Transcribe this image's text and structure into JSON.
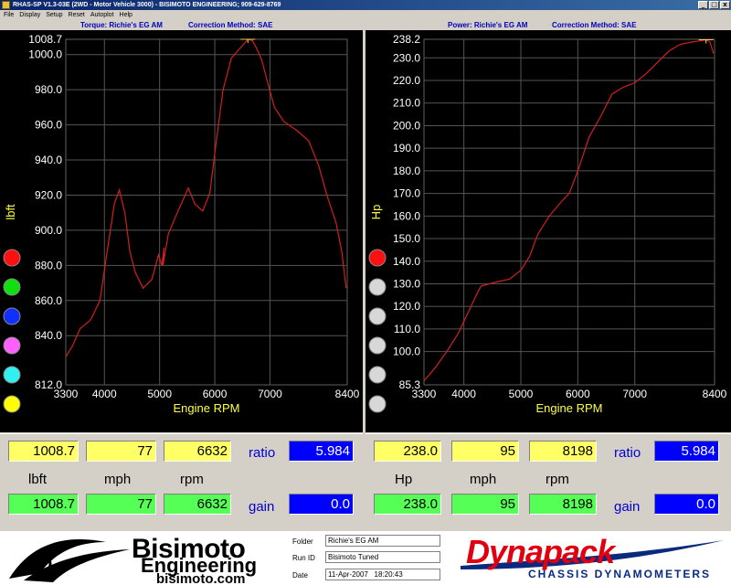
{
  "window": {
    "title": "RHAS-SP V1.3-03E  (2WD - Motor Vehicle 3000) - BISIMOTO ENGINEERING; 909-629-8769",
    "buttons": [
      "_",
      "□",
      "x"
    ]
  },
  "menu": [
    "File",
    "Display",
    "Setup",
    "Reset",
    "Autoplot",
    "Help"
  ],
  "torque": {
    "header_title": "Torque: Richie's EG AM",
    "header_method": "Correction Method: SAE",
    "ylabel": "lbft",
    "xlabel": "Engine RPM",
    "line_color": "#d02020",
    "run_buttons": [
      {
        "name": "red",
        "color": "#ff1010"
      },
      {
        "name": "green",
        "color": "#10e010"
      },
      {
        "name": "blue",
        "color": "#1030ff"
      },
      {
        "name": "magenta",
        "color": "#ff60ff"
      },
      {
        "name": "cyan",
        "color": "#30f0f0"
      },
      {
        "name": "yellow",
        "color": "#ffff00"
      }
    ],
    "readout": {
      "value1": "1008.7",
      "value2": "77",
      "value3": "6632",
      "ratio_label": "ratio",
      "ratio_value": "5.984",
      "unit1": "lbft",
      "unit2": "mph",
      "unit3": "rpm",
      "gvalue1": "1008.7",
      "gvalue2": "77",
      "gvalue3": "6632",
      "gain_label": "gain",
      "gain_value": "0.0"
    }
  },
  "power": {
    "header_title": "Power: Richie's EG AM",
    "header_method": "Correction Method: SAE",
    "ylabel": "Hp",
    "xlabel": "Engine RPM",
    "line_color": "#d02020",
    "run_buttons": [
      {
        "name": "red",
        "color": "#ff1010"
      },
      {
        "name": "grey-1",
        "color": "#d8d8d8"
      },
      {
        "name": "grey-2",
        "color": "#d8d8d8"
      },
      {
        "name": "grey-3",
        "color": "#d8d8d8"
      },
      {
        "name": "grey-4",
        "color": "#d8d8d8"
      },
      {
        "name": "grey-5",
        "color": "#d8d8d8"
      }
    ],
    "readout": {
      "value1": "238.0",
      "value2": "95",
      "value3": "8198",
      "ratio_label": "ratio",
      "ratio_value": "5.984",
      "unit1": "Hp",
      "unit2": "mph",
      "unit3": "rpm",
      "gvalue1": "238.0",
      "gvalue2": "95",
      "gvalue3": "8198",
      "gain_label": "gain",
      "gain_value": "0.0"
    }
  },
  "footer": {
    "brand_name": "Bisimoto",
    "brand_sub": "Engineering",
    "brand_url": "bisimoto.com",
    "folder_label": "Folder",
    "folder_value": "Richie's EG AM",
    "runid_label": "Run ID",
    "runid_value": "Bisimoto Tuned",
    "date_label": "Date",
    "date_value": "11-Apr-2007   18:20:43",
    "dynapack_name": "Dynapack",
    "dynapack_sub": "CHASSIS DYNAMOMETERS"
  },
  "chart_data": [
    {
      "type": "line",
      "title": "Torque: Richie's EG AM",
      "subtitle": "Correction Method: SAE",
      "xlabel": "Engine RPM",
      "ylabel": "lbft",
      "xlim": [
        3300,
        8400
      ],
      "ylim": [
        812.0,
        1008.7
      ],
      "x_ticks": [
        "3300",
        "4000",
        "5000",
        "6000",
        "7000",
        "8400"
      ],
      "y_ticks": [
        "812.0",
        "840.0",
        "860.0",
        "880.0",
        "900.0",
        "920.0",
        "940.0",
        "960.0",
        "980.0",
        "1000.0",
        "1008.7"
      ],
      "grid": true,
      "series": [
        {
          "x": [
            3300,
            3420,
            3560,
            3750,
            3920,
            4050,
            4180,
            4270,
            4370,
            4460,
            4560,
            4700,
            4860,
            4980,
            5040,
            5080,
            5060,
            5160,
            5320,
            5520,
            5640,
            5780,
            5910,
            6000,
            6150,
            6300,
            6470,
            6600,
            6680,
            6750,
            6850,
            6950,
            7080,
            7250,
            7480,
            7700,
            7880,
            8050,
            8200,
            8300,
            8380
          ],
          "y": [
            828,
            834,
            844,
            849,
            860,
            888,
            915,
            923,
            910,
            888,
            876,
            867,
            872,
            886,
            880,
            890,
            880,
            898,
            910,
            924,
            915,
            911,
            921,
            944,
            980,
            998,
            1004,
            1008.7,
            1008,
            1004,
            997,
            985,
            970,
            962,
            957,
            951,
            937,
            918,
            904,
            888,
            867
          ]
        }
      ]
    },
    {
      "type": "line",
      "title": "Power: Richie's EG AM",
      "subtitle": "Correction Method: SAE",
      "xlabel": "Engine RPM",
      "ylabel": "Hp",
      "xlim": [
        3300,
        8400
      ],
      "ylim": [
        85.3,
        238.2
      ],
      "x_ticks": [
        "3300",
        "4000",
        "5000",
        "6000",
        "7000",
        "8400"
      ],
      "y_ticks": [
        "85.3",
        "100.0",
        "110.0",
        "120.0",
        "130.0",
        "140.0",
        "150.0",
        "160.0",
        "170.0",
        "180.0",
        "190.0",
        "200.0",
        "210.0",
        "220.0",
        "230.0",
        "238.2"
      ],
      "grid": true,
      "series": [
        {
          "x": [
            3300,
            3500,
            3700,
            3900,
            4050,
            4200,
            4300,
            4450,
            4600,
            4800,
            5000,
            5150,
            5300,
            5500,
            5700,
            5850,
            6000,
            6200,
            6400,
            6600,
            6800,
            7000,
            7200,
            7400,
            7600,
            7800,
            8000,
            8150,
            8250,
            8320,
            8380
          ],
          "y": [
            87,
            93,
            100,
            108,
            116,
            124,
            129,
            130,
            131,
            132,
            136,
            142,
            152,
            160,
            166,
            170,
            180,
            195,
            204,
            214,
            217,
            219,
            223,
            228,
            233,
            236,
            237,
            237.5,
            238,
            237,
            232
          ]
        }
      ]
    }
  ]
}
